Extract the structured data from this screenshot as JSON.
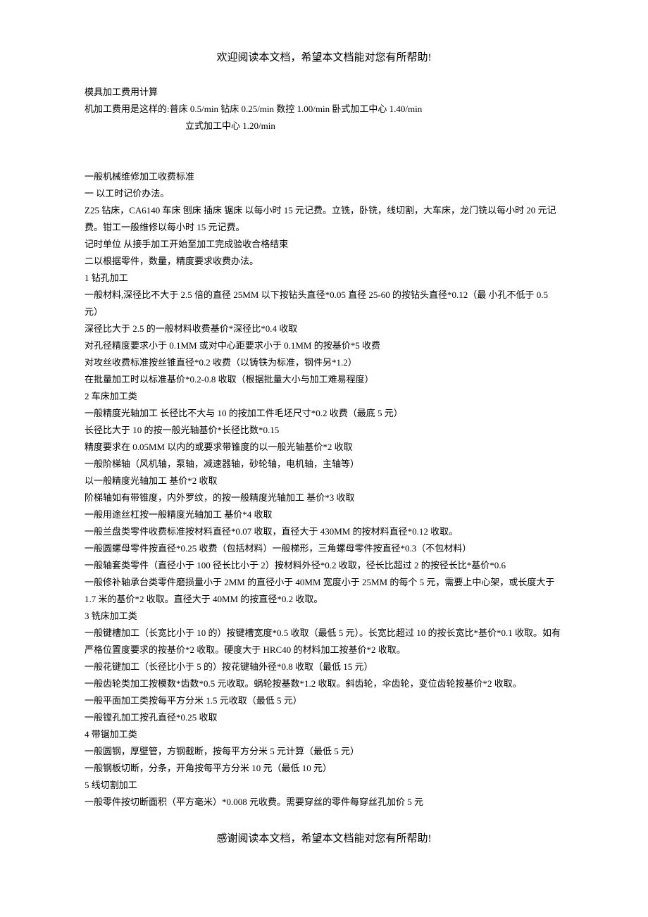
{
  "header": "欢迎阅读本文档，希望本文档能对您有所帮助!",
  "footer": "感谢阅读本文档，希望本文档能对您有所帮助!",
  "lines": [
    "模具加工费用计算",
    "机加工费用是这样的:普床 0.5/min 钻床 0.25/min 数控 1.00/min  卧式加工中心 1.40/min",
    {
      "indent": true,
      "text": "立式加工中心 1.20/min"
    },
    {
      "spacer": 2
    },
    "一般机械维修加工收费标准",
    "一 以工时记价办法。",
    "Z25 钻床，CA6140 车床 刨床 插床 锯床 以每小时 15 元记费。立铣，卧铣，线切割，大车床，龙门铣以每小时 20 元记费。钳工一般维修以每小时 15 元记费。",
    "记时单位 从接手加工开始至加工完成验收合格结束",
    "二以根据零件，数量，精度要求收费办法。",
    "1 钻孔加工",
    "一般材料,深径比不大于 2.5 倍的直径 25MM 以下按钻头直径*0.05 直径 25-60 的按钻头直径*0.12（最 小孔不低于 0.5 元）",
    "深径比大于 2.5 的一般材料收费基价*深径比*0.4 收取",
    "对孔径精度要求小于 0.1MM 或对中心距要求小于 0.1MM 的按基价*5 收费",
    "对攻丝收费标准按丝锥直径*0.2 收费（以铸铁为标准，钢件另*1.2）",
    "在批量加工时以标准基价*0.2-0.8 收取（根据批量大小与加工难易程度）",
    "2 车床加工类",
    "一般精度光轴加工 长径比不大与 10 的按加工件毛坯尺寸*0.2 收费（最底 5 元）",
    "长径比大于 10 的按一般光轴基价*长径比数*0.15",
    "精度要求在 0.05MM 以内的或要求带锥度的以一般光轴基价*2 收取",
    "一般阶梯轴（风机轴，泵轴，减速器轴，砂轮轴，电机轴，主轴等）",
    "以一般精度光轴加工 基价*2 收取",
    "阶梯轴如有带锥度，内外罗纹，的按一般精度光轴加工 基价*3 收取",
    "一般用途丝杠按一般精度光轴加工 基价*4 收取",
    "一般兰盘类零件收费标准按材料直径*0.07 收取，直径大于 430MM 的按材料直径*0.12 收取。",
    "一般圆螺母零件按直径*0.25 收费（包括材料）一般梯形，三角螺母零件按直径*0.3（不包材料）",
    "一般轴套类零件（直径小于 100 径长比小于 2）按材料外径*0.2 收取，径长比超过 2 的按径长比*基价*0.6",
    "一般修补轴承台类零件磨损量小于 2MM 的直径小于 40MM 宽度小于 25MM 的每个 5 元，需要上中心架，或长度大于 1.7 米的基价*2 收取。直径大于 40MM 的按直径*0.2 收取。",
    "3 铣床加工类",
    "一般键槽加工（长宽比小于 10 的）按键槽宽度*0.5 收取（最低 5 元）。长宽比超过 10 的按长宽比*基价*0.1 收取。如有严格位置度要求的按基价*2 收取。硬度大于 HRC40 的材料加工按基价*2 收取。",
    "一般花键加工（长径比小于 5 的）按花键轴外径*0.8 收取（最低 15 元）",
    "一般齿轮类加工按模数*齿数*0.5 元收取。蜗轮按基数*1.2 收取。斜齿轮，伞齿轮，变位齿轮按基价*2 收取。",
    "一般平面加工类按每平方分米 1.5 元收取（最低 5 元）",
    "一般镗孔加工按孔直径*0.25 收取",
    "4 带锯加工类",
    "一般圆钢，厚壁管，方钢截断，按每平方分米 5 元计算（最低 5 元）",
    "一般钢板切断，分条，开角按每平方分米 10 元（最低 10 元）",
    "5 线切割加工",
    "一般零件按切断面积（平方毫米）*0.008 元收费。需要穿丝的零件每穿丝孔加价 5 元"
  ]
}
